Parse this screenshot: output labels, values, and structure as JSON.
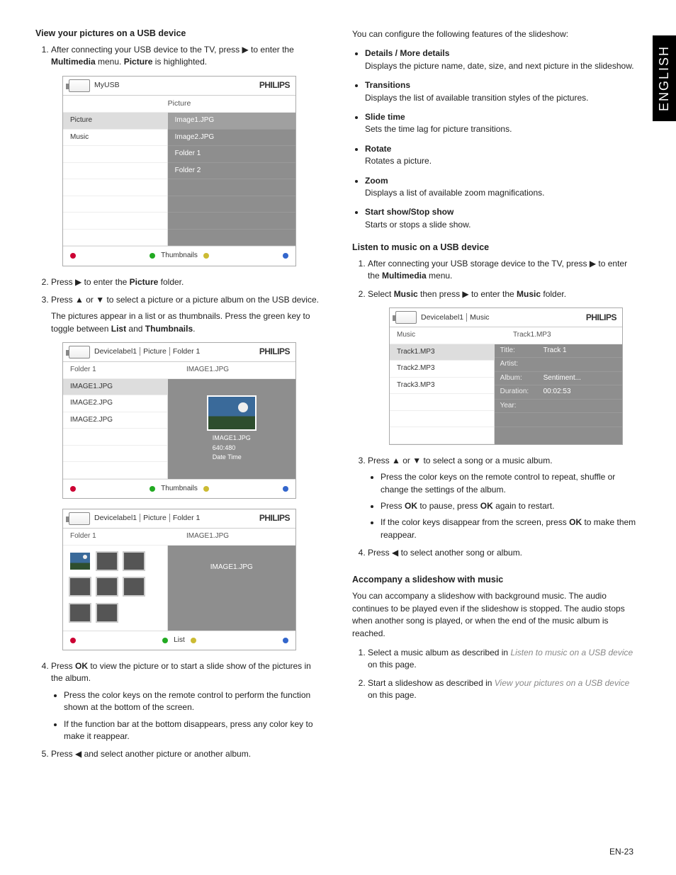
{
  "lang_tab": "ENGLISH",
  "page_number": "EN-23",
  "brand": "PHILIPS",
  "arrows": {
    "right": "▶",
    "left": "◀",
    "up": "▲",
    "down": "▼"
  },
  "left": {
    "h_view": "View your pictures on a USB device",
    "step1_a": "After connecting your USB device to the TV, press ",
    "step1_b": " to enter the ",
    "step1_c": " menu.  ",
    "step1_d": " is highlighted.",
    "multimedia": "Multimedia",
    "picture": "Picture",
    "step2_a": "Press ",
    "step2_b": " to enter the ",
    "step2_c": " folder.",
    "step3_a": "Press ",
    "step3_b": " or ",
    "step3_c": " to select a picture or a picture album on the USB device.",
    "step3_p2_a": "The pictures appear in a list or as thumbnails.  Press the green key to toggle between ",
    "step3_p2_b": " and ",
    "step3_p2_c": ".",
    "list": "List",
    "thumbnails": "Thumbnails",
    "step4_a": "Press ",
    "step4_b": " to view the picture or to start a slide show of the pictures in the album.",
    "ok": "OK",
    "step4_sub1": "Press the color keys on the remote control to perform the function shown at the bottom of the screen.",
    "step4_sub2": "If the function bar at the bottom disappears, press any color key to make it reappear.",
    "step5_a": "Press ",
    "step5_b": " and select another picture or another album."
  },
  "right": {
    "intro": "You can configure the following features of the slideshow:",
    "features": [
      {
        "t": "Details / More details",
        "d": "Displays the picture name, date, size, and next picture in the slideshow."
      },
      {
        "t": "Transitions",
        "d": "Displays the list of available transition styles of the pictures."
      },
      {
        "t": "Slide time",
        "d": "Sets the time lag for picture transitions."
      },
      {
        "t": "Rotate",
        "d": "Rotates a picture."
      },
      {
        "t": "Zoom",
        "d": "Displays a list of available zoom magnifications."
      },
      {
        "t": "Start show/Stop show",
        "d": "Starts or stops a slide show."
      }
    ],
    "h_listen": "Listen to music on a USB device",
    "l_step1_a": "After connecting your USB storage device to the TV, press ",
    "l_step1_b": " to enter the ",
    "l_step1_c": " menu.",
    "l_step2_a": "Select ",
    "l_step2_b": " then press ",
    "l_step2_c": " to enter the ",
    "l_step2_d": " folder.",
    "music": "Music",
    "l_step3_a": "Press ",
    "l_step3_b": " or ",
    "l_step3_c": " to select a song or a music album.",
    "l_sub1": "Press the color keys on the remote control to repeat, shuffle or change the settings of the album.",
    "l_sub2_a": "Press ",
    "l_sub2_b": " to pause, press ",
    "l_sub2_c": " again to restart.",
    "l_sub3_a": "If the color keys disappear from the screen, press ",
    "l_sub3_b": " to make them reappear.",
    "l_step4_a": "Press ",
    "l_step4_b": " to select another song or album.",
    "h_accompany": "Accompany a slideshow with music",
    "acc_intro": "You can accompany a slideshow with background music.  The audio continues to be played even if the slideshow is stopped.  The audio stops when another song is played, or when the end of the music album is reached.",
    "acc_s1_a": "Select a music album as described in ",
    "acc_s1_b": "Listen to music on a USB device",
    "acc_s1_c": " on this page.",
    "acc_s2_a": "Start a slideshow as described in ",
    "acc_s2_b": "View your pictures on a USB device",
    "acc_s2_c": " on this page."
  },
  "ui1": {
    "crumb": "MyUSB",
    "left_title": "",
    "right_title": "Picture",
    "left_items": [
      "Picture",
      "Music"
    ],
    "right_items": [
      "Image1.JPG",
      "Image2.JPG",
      "Folder 1",
      "Folder 2"
    ],
    "footer": "Thumbnails"
  },
  "ui2": {
    "crumb1": "Devicelabel1",
    "crumb2": "Picture",
    "crumb3": "Folder 1",
    "left_title": "Folder 1",
    "right_title": "IMAGE1.JPG",
    "left_items": [
      "IMAGE1.JPG",
      "IMAGE2.JPG",
      "IMAGE2.JPG"
    ],
    "preview_name": "IMAGE1.JPG",
    "preview_res": "640:480",
    "preview_date": "Date   Time",
    "footer": "Thumbnails"
  },
  "ui3": {
    "crumb1": "Devicelabel1",
    "crumb2": "Picture",
    "crumb3": "Folder 1",
    "left_title": "Folder 1",
    "right_title": "IMAGE1.JPG",
    "thumb_label": "IMAGE1.JPG",
    "footer": "List"
  },
  "ui4": {
    "crumb1": "Devicelabel1",
    "crumb2": "Music",
    "left_title": "Music",
    "right_title": "Track1.MP3",
    "left_items": [
      "Track1.MP3",
      "Track2.MP3",
      "Track3.MP3"
    ],
    "meta": [
      {
        "k": "Title:",
        "v": "Track 1"
      },
      {
        "k": "Artist:",
        "v": ""
      },
      {
        "k": "Album:",
        "v": "Sentiment..."
      },
      {
        "k": "Duration:",
        "v": "00:02:53"
      },
      {
        "k": "Year:",
        "v": ""
      }
    ]
  }
}
